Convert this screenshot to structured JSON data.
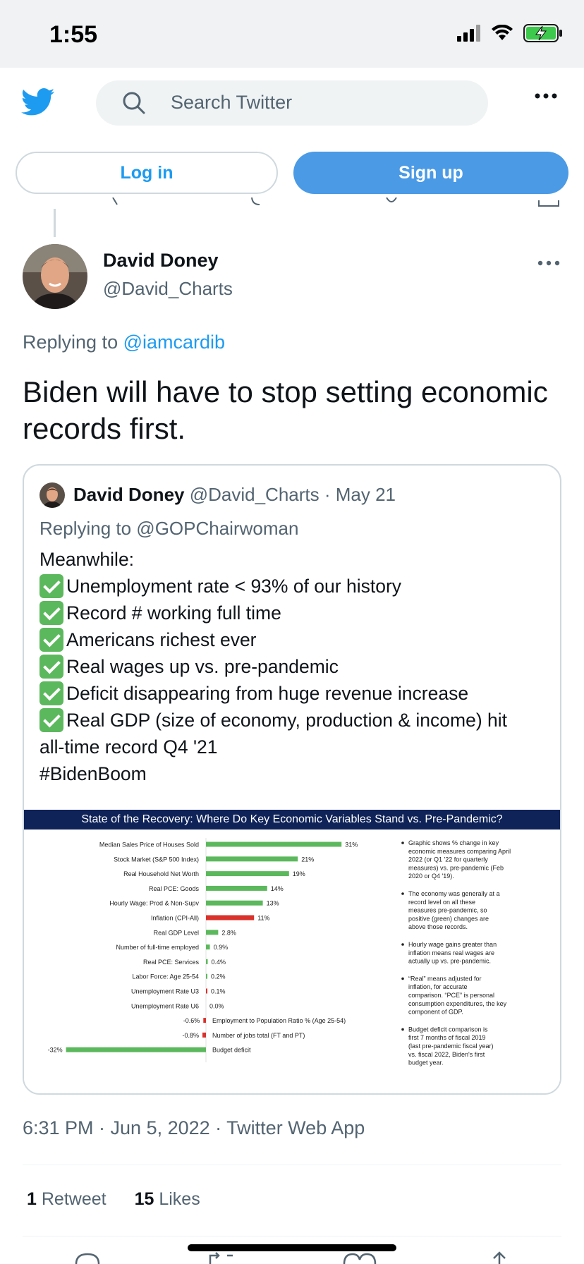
{
  "status_bar": {
    "time": "1:55"
  },
  "header": {
    "search_placeholder": "Search Twitter"
  },
  "auth": {
    "login_label": "Log in",
    "signup_label": "Sign up"
  },
  "tweet": {
    "author_name": "David Doney",
    "author_handle": "@David_Charts",
    "replying_prefix": "Replying to",
    "replying_to": "@iamcardib",
    "text": "Biden will have to stop setting economic records first.",
    "timestamp": "6:31 PM · Jun 5, 2022 · Twitter Web App",
    "retweets_count": "1",
    "retweets_label": "Retweet",
    "likes_count": "15",
    "likes_label": "Likes"
  },
  "quote": {
    "author_name": "David Doney",
    "meta": "@David_Charts · May 21",
    "replying": "Replying to @GOPChairwoman",
    "intro": "Meanwhile:",
    "items": [
      "Unemployment rate < 93% of our history",
      "Record # working full time",
      "Americans richest ever",
      "Real wages up vs. pre-pandemic",
      "Deficit disappearing from huge revenue increase",
      "Real GDP (size of economy, production & income) hit"
    ],
    "continuation": "all-time record Q4 '21",
    "hashtag": "#BidenBoom"
  },
  "colors": {
    "positive": "#5cb85c",
    "negative": "#d9312b",
    "title_bg": "#0f2358",
    "link": "#1d9bf0"
  },
  "chart_data": {
    "type": "bar",
    "title": "State of the Recovery:  Where Do Key Economic Variables Stand vs. Pre-Pandemic?",
    "categories": [
      "Median Sales Price of Houses Sold",
      "Stock Market (S&P 500 Index)",
      "Real Household Net Worth",
      "Real PCE:  Goods",
      "Hourly Wage:  Prod & Non-Supv",
      "Inflation (CPI-All)",
      "Real GDP Level",
      "Number of full-time employed",
      "Real PCE:  Services",
      "Labor Force:  Age 25-54",
      "Unemployment Rate U3",
      "Unemployment Rate U6",
      "Employment to Population Ratio % (Age 25-54)",
      "Number of jobs total (FT and PT)",
      "Budget deficit"
    ],
    "values": [
      31,
      21,
      19,
      14,
      13,
      11,
      2.8,
      0.9,
      0.4,
      0.2,
      0.1,
      0.0,
      -0.6,
      -0.8,
      -32
    ],
    "value_labels": [
      "31%",
      "21%",
      "19%",
      "14%",
      "13%",
      "11%",
      "2.8%",
      "0.9%",
      "0.4%",
      "0.2%",
      "0.1%",
      "0.0%",
      "-0.6%",
      "-0.8%",
      "-32%"
    ],
    "bar_colors": [
      "#5cb85c",
      "#5cb85c",
      "#5cb85c",
      "#5cb85c",
      "#5cb85c",
      "#d9312b",
      "#5cb85c",
      "#5cb85c",
      "#5cb85c",
      "#5cb85c",
      "#d9312b",
      "#5cb85c",
      "#d9312b",
      "#d9312b",
      "#5cb85c"
    ],
    "xlim": [
      -32,
      31
    ],
    "notes": [
      "Graphic shows % change in key economic measures comparing April 2022 (or Q1 '22 for quarterly measures) vs. pre-pandemic (Feb 2020 or Q4 '19).",
      "The economy was generally at a record level on all these measures pre-pandemic, so positive (green) changes are above those records.",
      "Hourly wage gains greater than inflation means real wages are actually up vs. pre-pandemic.",
      "“Real” means adjusted for inflation, for accurate comparison.  “PCE” is personal consumption expenditures, the key component of GDP.",
      "Budget deficit comparison is first 7 months of fiscal 2019 (last pre-pandemic fiscal year) vs. fiscal 2022, Biden's first budget year."
    ]
  }
}
